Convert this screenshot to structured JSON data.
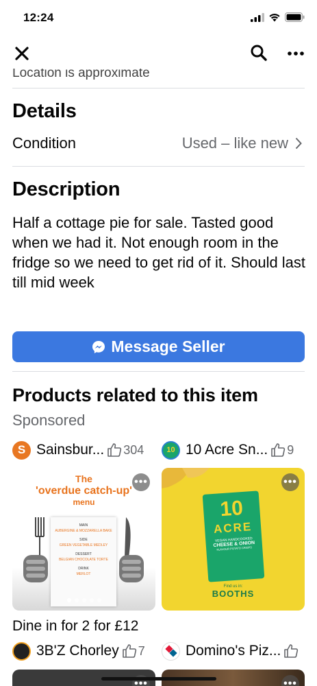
{
  "status": {
    "time": "12:24"
  },
  "location_note": "Location is approximate",
  "details": {
    "title": "Details",
    "condition_label": "Condition",
    "condition_value": "Used – like new"
  },
  "description": {
    "title": "Description",
    "text": "Half a cottage pie for sale. Tasted good when we had it. Not enough room in the fridge so we need to get rid of it. Should last till mid week"
  },
  "message_button": "Message Seller",
  "related": {
    "title": "Products related to this item",
    "sponsored": "Sponsored",
    "advertisers_top": [
      {
        "name": "Sainsbur...",
        "likes": "304",
        "logo_letter": "S",
        "logo_color": "#e87722"
      },
      {
        "name": "10 Acre Sn...",
        "likes": "9",
        "logo_letter": "10",
        "logo_color": "#1aa56a"
      }
    ],
    "card1": {
      "headline": "The",
      "headline2": "'overdue catch-up'",
      "headline3": "menu",
      "menu": [
        "MAIN",
        "AUBERGINE & MOZZARELLA BAKE",
        "SIDE",
        "GREEN VEGETABLE MEDLEY",
        "DESSERT",
        "BELGIAN CHOCOLATE TORTE",
        "DRINK",
        "MERLOT"
      ]
    },
    "card2": {
      "brand_top": "10",
      "brand": "ACRE",
      "flavour_line1": "VEGAN HANDCOOKED",
      "flavour_line2": "CHEESE & ONION",
      "flavour_line3": "FLAVOUR POTATO CRISPS",
      "find": "Find us in:",
      "store": "BOOTHS"
    },
    "card1_caption": "Dine in for 2 for £12",
    "advertisers_bottom": [
      {
        "name": "3B'Z Chorley",
        "likes": "7"
      },
      {
        "name": "Domino's Piz...",
        "likes": ""
      }
    ]
  },
  "more_icon_text": "•••",
  "colors": {
    "accent": "#3b78e0",
    "sainsburys": "#e87722",
    "acre_green": "#1aa56a",
    "card2_bg": "#f2d52f"
  }
}
